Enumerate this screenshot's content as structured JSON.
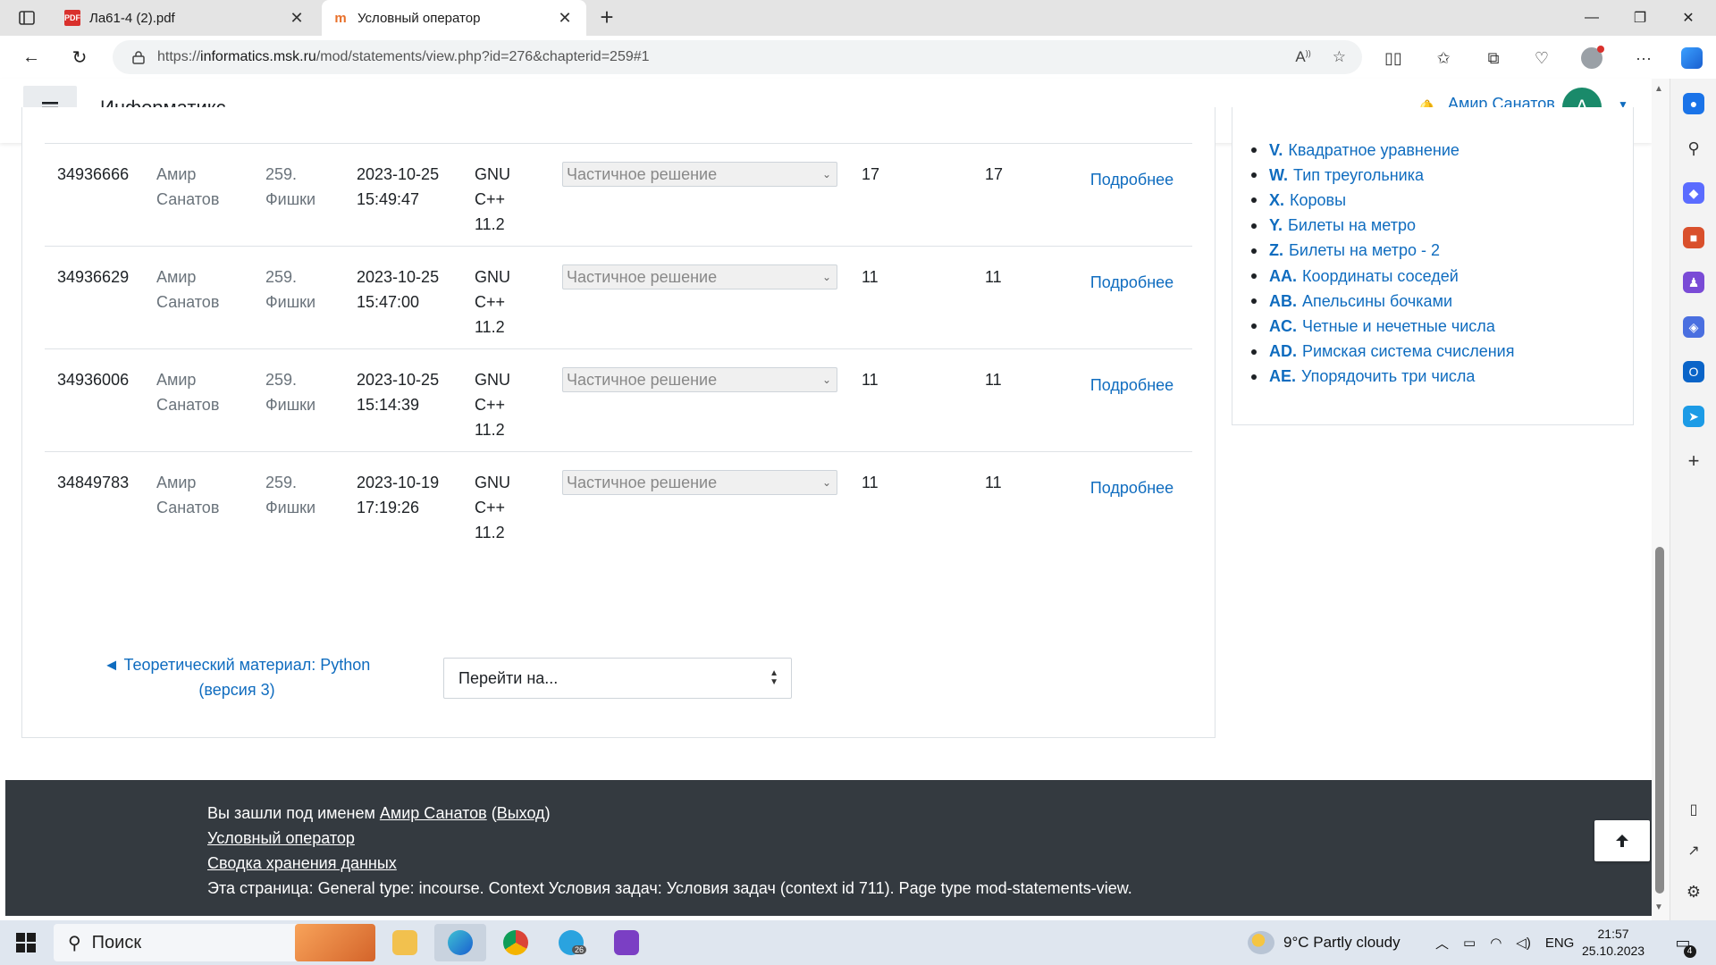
{
  "browser": {
    "tabs": [
      {
        "title": "Ла61-4 (2).pdf",
        "favicon": "pdf-icon",
        "active": false
      },
      {
        "title": "Условный оператор",
        "favicon": "informatics-icon",
        "active": true
      }
    ],
    "url_prefix": "https://",
    "url_host": "informatics.msk.ru",
    "url_path": "/mod/statements/view.php?id=276&chapterid=259#1"
  },
  "header": {
    "brand": "Информатикс",
    "user_name": "Амир Санатов",
    "avatar_letter": "A"
  },
  "submissions": [
    {
      "id": "34936666",
      "user1": "Амир",
      "user2": "Санатов",
      "prob1": "259.",
      "prob2": "Фишки",
      "date": "2023-10-25",
      "time": "15:49:47",
      "lang1": "GNU",
      "lang2": "C++",
      "lang3": "11.2",
      "status": "Частичное решение",
      "score1": "17",
      "score2": "17",
      "more": "Подробнее"
    },
    {
      "id": "34936629",
      "user1": "Амир",
      "user2": "Санатов",
      "prob1": "259.",
      "prob2": "Фишки",
      "date": "2023-10-25",
      "time": "15:47:00",
      "lang1": "GNU",
      "lang2": "C++",
      "lang3": "11.2",
      "status": "Частичное решение",
      "score1": "11",
      "score2": "11",
      "more": "Подробнее"
    },
    {
      "id": "34936006",
      "user1": "Амир",
      "user2": "Санатов",
      "prob1": "259.",
      "prob2": "Фишки",
      "date": "2023-10-25",
      "time": "15:14:39",
      "lang1": "GNU",
      "lang2": "C++",
      "lang3": "11.2",
      "status": "Частичное решение",
      "score1": "11",
      "score2": "11",
      "more": "Подробнее"
    },
    {
      "id": "34849783",
      "user1": "Амир",
      "user2": "Санатов",
      "prob1": "259.",
      "prob2": "Фишки",
      "date": "2023-10-19",
      "time": "17:19:26",
      "lang1": "GNU",
      "lang2": "C++",
      "lang3": "11.2",
      "status": "Частичное решение",
      "score1": "11",
      "score2": "11",
      "more": "Подробнее"
    }
  ],
  "navigation": {
    "prev_line1": "◄ Теоретический материал: Python",
    "prev_line2": "(версия 3)",
    "jump_placeholder": "Перейти на..."
  },
  "problem_list": [
    {
      "code": "V.",
      "name": "Квадратное уравнение"
    },
    {
      "code": "W.",
      "name": "Тип треугольника"
    },
    {
      "code": "X.",
      "name": "Коровы"
    },
    {
      "code": "Y.",
      "name": "Билеты на метро"
    },
    {
      "code": "Z.",
      "name": "Билеты на метро - 2"
    },
    {
      "code": "AA.",
      "name": "Координаты соседей"
    },
    {
      "code": "AB.",
      "name": "Апельсины бочками"
    },
    {
      "code": "AC.",
      "name": "Четные и нечетные числа"
    },
    {
      "code": "AD.",
      "name": "Римская система счисления"
    },
    {
      "code": "AE.",
      "name": "Упорядочить три числа"
    }
  ],
  "footer": {
    "logged_in_prefix": "Вы зашли под именем",
    "user": "Амир Санатов",
    "logout": "Выход",
    "course_link": "Условный оператор",
    "data_retention": "Сводка хранения данных",
    "page_info": "Эта страница: General type: incourse. Context Условия задач: Условия задач (context id 711). Page type mod-statements-view."
  },
  "taskbar": {
    "search_label": "Поиск",
    "weather": "9°C  Partly cloudy",
    "language": "ENG",
    "time": "21:57",
    "date": "25.10.2023",
    "notifications": "4",
    "telegram_badge": "26"
  },
  "colors": {
    "link": "#0f6cbf",
    "footer_bg": "#343a40",
    "avatar_bg": "#1a8a6a"
  }
}
